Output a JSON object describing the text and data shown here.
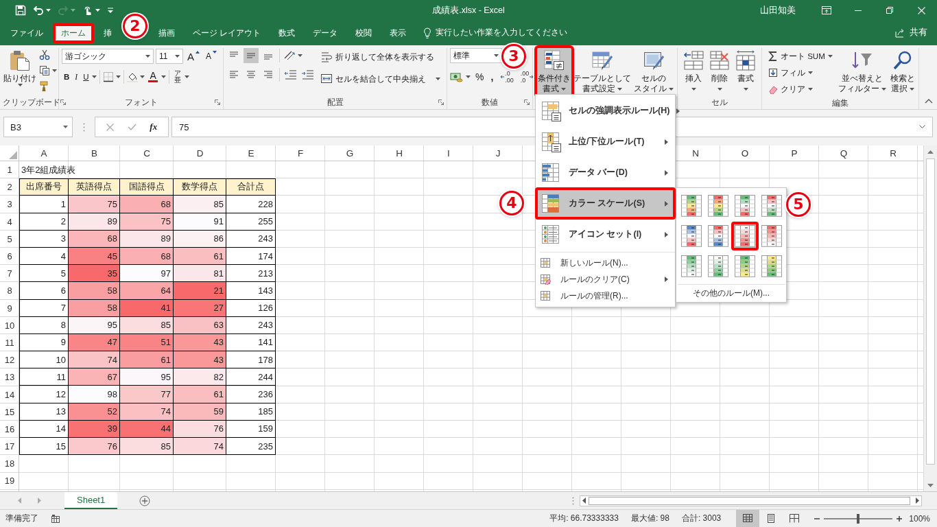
{
  "title_bar": {
    "title": "成績表.xlsx - Excel",
    "user": "山田知美",
    "redo_disabled": true
  },
  "tabs": [
    {
      "label": "ファイル",
      "selected": false,
      "marked": false
    },
    {
      "label": "ホーム",
      "selected": true,
      "marked": true
    },
    {
      "label": "挿",
      "selected": false,
      "marked": false,
      "callout": "2"
    },
    {
      "label": "描画",
      "selected": false,
      "marked": false
    },
    {
      "label": "ページ レイアウト",
      "selected": false,
      "marked": false
    },
    {
      "label": "数式",
      "selected": false,
      "marked": false
    },
    {
      "label": "データ",
      "selected": false,
      "marked": false
    },
    {
      "label": "校閲",
      "selected": false,
      "marked": false
    },
    {
      "label": "表示",
      "selected": false,
      "marked": false
    }
  ],
  "tell_me": "実行したい作業を入力してください",
  "share": "共有",
  "ribbon": {
    "clipboard": {
      "label": "クリップボード",
      "paste": "貼り付け"
    },
    "font": {
      "label": "フォント",
      "name": "游ゴシック",
      "size": "11",
      "grow": "A",
      "shrink": "A",
      "bold": "B",
      "italic": "I",
      "underline": "U",
      "color_letter": "A",
      "phonetic": [
        "ア",
        "亜"
      ]
    },
    "alignment": {
      "label": "配置",
      "vertical": [
        {
          "selected": false
        },
        {
          "selected": true
        },
        {
          "selected": false
        }
      ],
      "wrap": "折り返して全体を表示する",
      "merge": "セルを結合して中央揃え"
    },
    "number": {
      "label": "数値",
      "format": "標準",
      "percent": "%",
      "comma": ",",
      "increase_decimal": [
        ".0",
        ".00"
      ],
      "decrease_decimal": [
        ".00",
        ".0"
      ]
    },
    "styles": [
      {
        "lines": [
          "条件付き",
          "書式"
        ],
        "pressed": true,
        "marked": true,
        "callout": "3"
      },
      {
        "lines": [
          "テーブルとして",
          "書式設定"
        ],
        "pressed": false,
        "marked": false
      },
      {
        "lines": [
          "セルの",
          "スタイル"
        ],
        "pressed": false,
        "marked": false
      }
    ],
    "cells": {
      "label": "セル",
      "buttons": [
        "挿入",
        "削除",
        "書式"
      ]
    },
    "editing": {
      "label": "編集",
      "autosum": "オート SUM",
      "fill": "フィル",
      "clear": "クリア",
      "sort": [
        "並べ替えと",
        "フィルター"
      ],
      "find": [
        "検索と",
        "選択"
      ]
    }
  },
  "formula_bar": {
    "name_box": "B3",
    "function_label": "fx",
    "value": "75"
  },
  "sheet": {
    "columns": [
      "A",
      "B",
      "C",
      "D",
      "E",
      "F",
      "G",
      "H",
      "I",
      "J",
      null,
      null,
      null,
      "N",
      "O",
      "P",
      "Q",
      "R"
    ],
    "rows": [
      {
        "header": "1",
        "cells": [
          {
            "kind": "title",
            "text": "3年2組成績表"
          }
        ]
      },
      {
        "header": "2",
        "cells": [
          {
            "kind": "header",
            "text": "出席番号"
          },
          {
            "kind": "header",
            "text": "英語得点"
          },
          {
            "kind": "header",
            "text": "国語得点"
          },
          {
            "kind": "header",
            "text": "数学得点"
          },
          {
            "kind": "header",
            "text": "合計点"
          }
        ]
      },
      {
        "header": "3",
        "cells": [
          {
            "kind": "number",
            "text": "1"
          },
          {
            "kind": "number",
            "text": "75",
            "color": "#fbc6c9"
          },
          {
            "kind": "number",
            "text": "68",
            "color": "#fab0b2"
          },
          {
            "kind": "number",
            "text": "85",
            "color": "#fceff2"
          },
          {
            "kind": "number",
            "text": "228"
          }
        ]
      },
      {
        "header": "4",
        "cells": [
          {
            "kind": "number",
            "text": "2"
          },
          {
            "kind": "number",
            "text": "89",
            "color": "#fbe7ea"
          },
          {
            "kind": "number",
            "text": "75",
            "color": "#fac2c5"
          },
          {
            "kind": "number",
            "text": "91",
            "color": "#fcfcff"
          },
          {
            "kind": "number",
            "text": "255"
          }
        ]
      },
      {
        "header": "5",
        "cells": [
          {
            "kind": "number",
            "text": "3"
          },
          {
            "kind": "number",
            "text": "68",
            "color": "#fab6b9"
          },
          {
            "kind": "number",
            "text": "89",
            "color": "#fbe7ea"
          },
          {
            "kind": "number",
            "text": "86",
            "color": "#fcf2f4"
          },
          {
            "kind": "number",
            "text": "243"
          }
        ]
      },
      {
        "header": "6",
        "cells": [
          {
            "kind": "number",
            "text": "4"
          },
          {
            "kind": "number",
            "text": "45",
            "color": "#f98083"
          },
          {
            "kind": "number",
            "text": "68",
            "color": "#fab0b2"
          },
          {
            "kind": "number",
            "text": "61",
            "color": "#fabdc0"
          },
          {
            "kind": "number",
            "text": "174"
          }
        ]
      },
      {
        "header": "7",
        "cells": [
          {
            "kind": "number",
            "text": "5"
          },
          {
            "kind": "number",
            "text": "35",
            "color": "#f8696b"
          },
          {
            "kind": "number",
            "text": "97",
            "color": "#fcfcff"
          },
          {
            "kind": "number",
            "text": "81",
            "color": "#fbe7ea"
          },
          {
            "kind": "number",
            "text": "213"
          }
        ]
      },
      {
        "header": "8",
        "cells": [
          {
            "kind": "number",
            "text": "6"
          },
          {
            "kind": "number",
            "text": "58",
            "color": "#f99fa1"
          },
          {
            "kind": "number",
            "text": "64",
            "color": "#faa5a8"
          },
          {
            "kind": "number",
            "text": "21",
            "color": "#f8696b"
          },
          {
            "kind": "number",
            "text": "143"
          }
        ]
      },
      {
        "header": "9",
        "cells": [
          {
            "kind": "number",
            "text": "7"
          },
          {
            "kind": "number",
            "text": "58",
            "color": "#f99fa1"
          },
          {
            "kind": "number",
            "text": "41",
            "color": "#f8696b"
          },
          {
            "kind": "number",
            "text": "27",
            "color": "#f87678"
          },
          {
            "kind": "number",
            "text": "126"
          }
        ]
      },
      {
        "header": "10",
        "cells": [
          {
            "kind": "number",
            "text": "8"
          },
          {
            "kind": "number",
            "text": "95",
            "color": "#fcf5f8"
          },
          {
            "kind": "number",
            "text": "85",
            "color": "#fbdddf"
          },
          {
            "kind": "number",
            "text": "63",
            "color": "#fac1c4"
          },
          {
            "kind": "number",
            "text": "243"
          }
        ]
      },
      {
        "header": "11",
        "cells": [
          {
            "kind": "number",
            "text": "9"
          },
          {
            "kind": "number",
            "text": "47",
            "color": "#f98587"
          },
          {
            "kind": "number",
            "text": "51",
            "color": "#f98385"
          },
          {
            "kind": "number",
            "text": "43",
            "color": "#f99799"
          },
          {
            "kind": "number",
            "text": "141"
          }
        ]
      },
      {
        "header": "12",
        "cells": [
          {
            "kind": "number",
            "text": "10"
          },
          {
            "kind": "number",
            "text": "74",
            "color": "#fac4c7"
          },
          {
            "kind": "number",
            "text": "61",
            "color": "#f99da0"
          },
          {
            "kind": "number",
            "text": "43",
            "color": "#f99799"
          },
          {
            "kind": "number",
            "text": "178"
          }
        ]
      },
      {
        "header": "13",
        "cells": [
          {
            "kind": "number",
            "text": "11"
          },
          {
            "kind": "number",
            "text": "67",
            "color": "#fab4b6"
          },
          {
            "kind": "number",
            "text": "95",
            "color": "#fcf7fa"
          },
          {
            "kind": "number",
            "text": "82",
            "color": "#fbe9ec"
          },
          {
            "kind": "number",
            "text": "244"
          }
        ]
      },
      {
        "header": "14",
        "cells": [
          {
            "kind": "number",
            "text": "12"
          },
          {
            "kind": "number",
            "text": "98",
            "color": "#fcfcff"
          },
          {
            "kind": "number",
            "text": "77",
            "color": "#fbc8ca"
          },
          {
            "kind": "number",
            "text": "61",
            "color": "#fabdc0"
          },
          {
            "kind": "number",
            "text": "236"
          }
        ]
      },
      {
        "header": "15",
        "cells": [
          {
            "kind": "number",
            "text": "13"
          },
          {
            "kind": "number",
            "text": "52",
            "color": "#f99193"
          },
          {
            "kind": "number",
            "text": "74",
            "color": "#fac0c2"
          },
          {
            "kind": "number",
            "text": "59",
            "color": "#fab9bb"
          },
          {
            "kind": "number",
            "text": "185"
          }
        ]
      },
      {
        "header": "16",
        "cells": [
          {
            "kind": "number",
            "text": "14"
          },
          {
            "kind": "number",
            "text": "39",
            "color": "#f87274"
          },
          {
            "kind": "number",
            "text": "44",
            "color": "#f87173"
          },
          {
            "kind": "number",
            "text": "76",
            "color": "#fbdddf"
          },
          {
            "kind": "number",
            "text": "159"
          }
        ]
      },
      {
        "header": "17",
        "cells": [
          {
            "kind": "number",
            "text": "15"
          },
          {
            "kind": "number",
            "text": "76",
            "color": "#fbc9cb"
          },
          {
            "kind": "number",
            "text": "85",
            "color": "#fbdddf"
          },
          {
            "kind": "number",
            "text": "74",
            "color": "#fbd8db"
          },
          {
            "kind": "number",
            "text": "235"
          }
        ]
      },
      {
        "header": "18"
      },
      {
        "header": "19"
      }
    ]
  },
  "sheet_tabs": [
    {
      "label": "Sheet1",
      "selected": true
    }
  ],
  "status_bar": {
    "ready": "準備完了",
    "average": "平均: 66.73333333",
    "max": "最大値: 98",
    "sum": "合計: 3003",
    "views": [
      {
        "selected": true
      },
      {
        "selected": false
      },
      {
        "selected": false
      }
    ],
    "zoom": {
      "level": 0.5,
      "reading": "100%"
    }
  },
  "cf_menu": {
    "items": [
      {
        "kind": "highlight",
        "label": "セルの強調表示ルール(H)",
        "submenu": true,
        "selected": false,
        "marked": false
      },
      {
        "kind": "topbottom",
        "label": "上位/下位ルール(T)",
        "submenu": true,
        "selected": false,
        "marked": false
      },
      {
        "kind": "databar",
        "label": "データ バー(D)",
        "submenu": true,
        "selected": false,
        "marked": false
      },
      {
        "kind": "colorscale",
        "label": "カラー スケール(S)",
        "submenu": true,
        "selected": true,
        "marked": true,
        "callout": "4"
      },
      {
        "kind": "iconset",
        "label": "アイコン セット(I)",
        "submenu": true,
        "selected": false,
        "marked": false
      },
      {
        "kind": "new",
        "label": "新しいルール(N)...",
        "submenu": false,
        "selected": false,
        "marked": false
      },
      {
        "kind": "clear",
        "label": "ルールのクリア(C)",
        "submenu": true,
        "selected": false,
        "marked": false
      },
      {
        "kind": "manage",
        "label": "ルールの管理(R)...",
        "submenu": false,
        "selected": false,
        "marked": false
      }
    ],
    "color_scales": {
      "swatches": [
        {
          "selected": false,
          "marked": false
        },
        {
          "selected": false,
          "marked": false
        },
        {
          "selected": false,
          "marked": false
        },
        {
          "selected": false,
          "marked": false
        },
        {
          "selected": false,
          "marked": false
        },
        {
          "selected": false,
          "marked": false
        },
        {
          "selected": true,
          "marked": true,
          "callout": "5"
        },
        {
          "selected": false,
          "marked": false
        },
        {
          "selected": false,
          "marked": false
        },
        {
          "selected": false,
          "marked": false
        },
        {
          "selected": false,
          "marked": false
        },
        {
          "selected": false,
          "marked": false
        }
      ],
      "more": "その他のルール(M)..."
    }
  }
}
